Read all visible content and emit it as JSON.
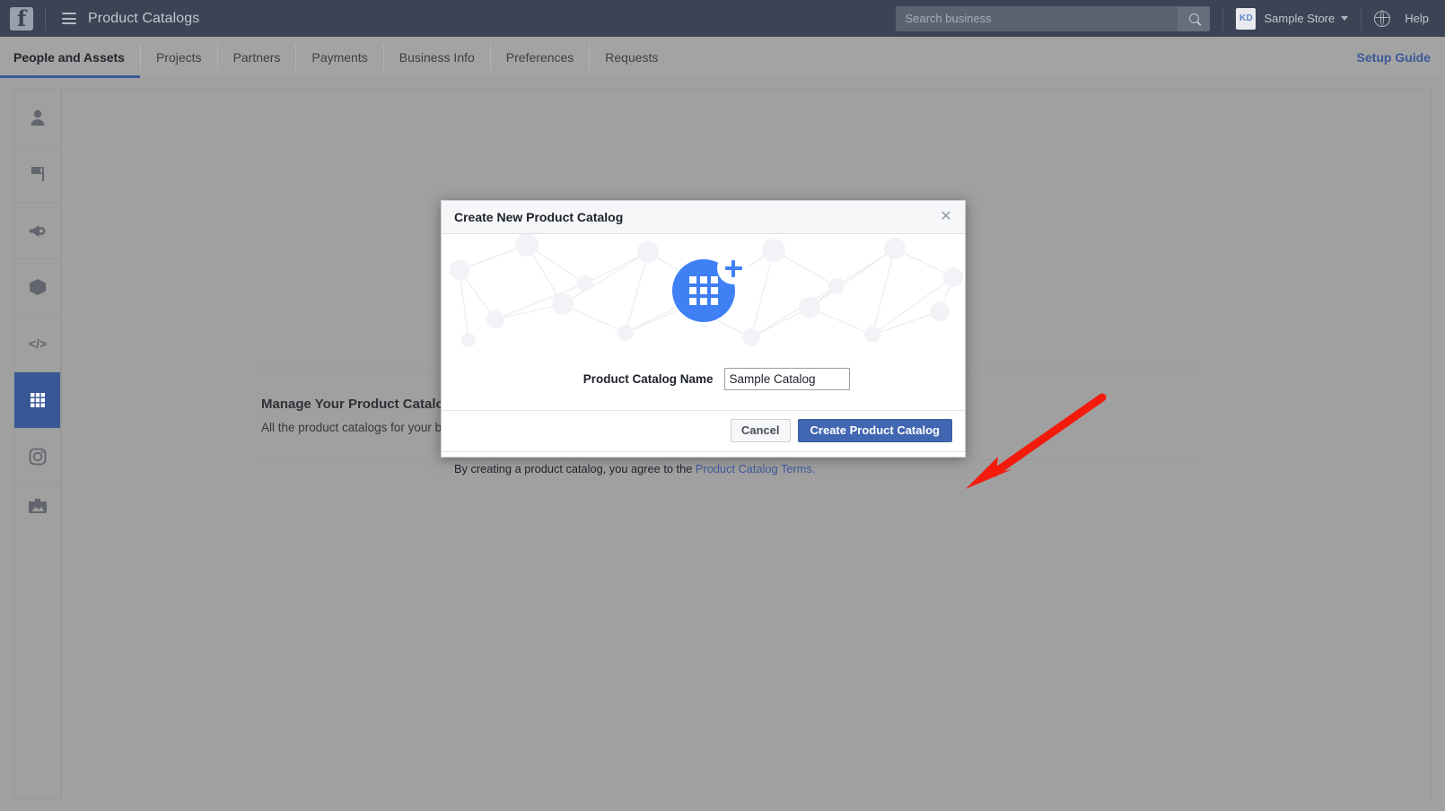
{
  "topbar": {
    "logo_name": "facebook-logo",
    "menu_icon": "hamburger-menu-icon",
    "app_title": "Product Catalogs",
    "search": {
      "placeholder": "Search business",
      "value": "",
      "icon": "search-icon"
    },
    "account_initials": "KD",
    "account_name": "Sample Store",
    "globe_icon": "globe-icon",
    "help_label": "Help"
  },
  "tabs": [
    {
      "label": "People and Assets",
      "active": true
    },
    {
      "label": "Projects",
      "active": false
    },
    {
      "label": "Partners",
      "active": false
    },
    {
      "label": "Payments",
      "active": false
    },
    {
      "label": "Business Info",
      "active": false
    },
    {
      "label": "Preferences",
      "active": false
    },
    {
      "label": "Requests",
      "active": false
    }
  ],
  "setup_guide_label": "Setup Guide",
  "sidebar": {
    "items": [
      {
        "icon": "person-icon",
        "selected": false
      },
      {
        "icon": "flag-icon",
        "selected": false
      },
      {
        "icon": "megaphone-icon",
        "selected": false
      },
      {
        "icon": "cube-icon",
        "selected": false
      },
      {
        "icon": "code-icon",
        "selected": false
      },
      {
        "icon": "grid-icon",
        "selected": true
      },
      {
        "icon": "instagram-icon",
        "selected": false
      },
      {
        "icon": "briefcase-image-icon",
        "selected": false
      }
    ]
  },
  "main": {
    "empty_state_icon": "list-circle-icon",
    "heading": "Manage Your Product Catalogs",
    "description": "All the product catalogs for your business, the people who work on them and their roles."
  },
  "modal": {
    "title": "Create New Product Catalog",
    "close_icon": "close-icon",
    "hero_icon": "catalog-grid-icon",
    "hero_add_icon": "plus-icon",
    "field_label": "Product Catalog Name",
    "field_value": "Sample Catalog",
    "field_placeholder": "",
    "cancel_label": "Cancel",
    "submit_label": "Create Product Catalog",
    "terms_prefix": "By creating a product catalog, you agree to the ",
    "terms_link": "Product Catalog Terms."
  },
  "annotation": {
    "arrow_icon": "red-arrow-pointer",
    "color": "#f31b0c"
  },
  "colors": {
    "topbar_bg": "#3b4354",
    "tabbar_bg": "#a3a3a3",
    "workspace_bg": "#a0a0a0",
    "accent_blue": "#3b5998",
    "primary_button": "#4267b2",
    "hero_blue": "#4080f5",
    "selected_rail": "#3a5795"
  }
}
